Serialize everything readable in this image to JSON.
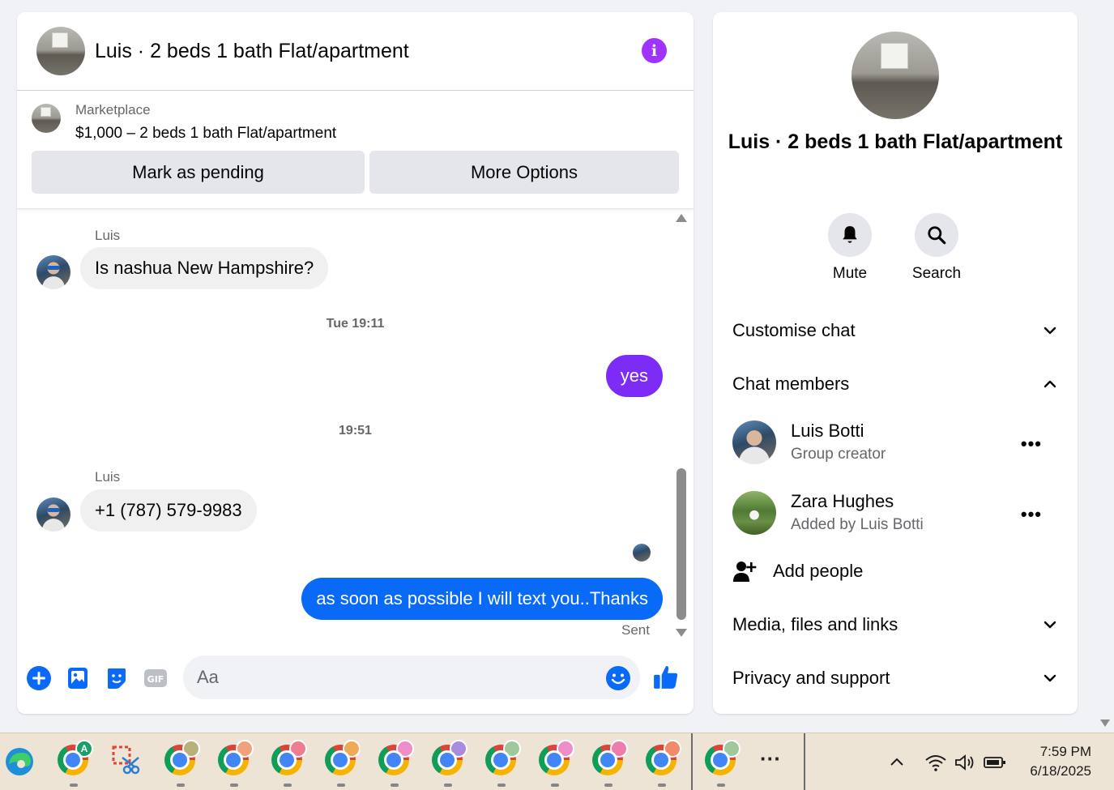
{
  "chat": {
    "title": "Luis · 2 beds 1 bath Flat/apartment",
    "listing": {
      "source": "Marketplace",
      "price_title": "$1,000 – 2 beds 1 bath Flat/apartment",
      "pending_label": "Mark as pending",
      "options_label": "More Options"
    },
    "messages": [
      {
        "sender": "Luis",
        "text": "Is nashua New Hampshire?",
        "direction": "incoming"
      },
      {
        "timestamp": "Tue 19:11"
      },
      {
        "text": "yes",
        "direction": "outgoing",
        "color": "#7d2cf5"
      },
      {
        "timestamp": "19:51"
      },
      {
        "sender": "Luis",
        "text": "+1 (787) 579-9983",
        "direction": "incoming"
      },
      {
        "text": "as soon as possible I will text you..Thanks",
        "direction": "outgoing",
        "color": "#0a6af8",
        "status": "Sent"
      }
    ],
    "composer": {
      "placeholder": "Aa",
      "icons": [
        "add-icon",
        "photo-icon",
        "sticker-icon",
        "gif-icon",
        "emoji-icon",
        "like-icon"
      ]
    }
  },
  "info_panel": {
    "title": "Luis · 2 beds 1 bath Flat/apartment",
    "actions": [
      {
        "label": "Mute",
        "icon": "bell-icon"
      },
      {
        "label": "Search",
        "icon": "search-icon"
      }
    ],
    "sections": {
      "customise": "Customise chat",
      "members": "Chat members",
      "media": "Media, files and links",
      "privacy": "Privacy and support"
    },
    "members": [
      {
        "name": "Luis Botti",
        "subtitle": "Group creator"
      },
      {
        "name": "Zara Hughes",
        "subtitle": "Added by Luis Botti"
      }
    ],
    "add_people": "Add people"
  },
  "taskbar": {
    "time": "7:59 PM",
    "date": "6/18/2025",
    "profile_badge": "A",
    "colors": {
      "accent_blue": "#0a6af8",
      "accent_purple": "#a033ff"
    }
  }
}
